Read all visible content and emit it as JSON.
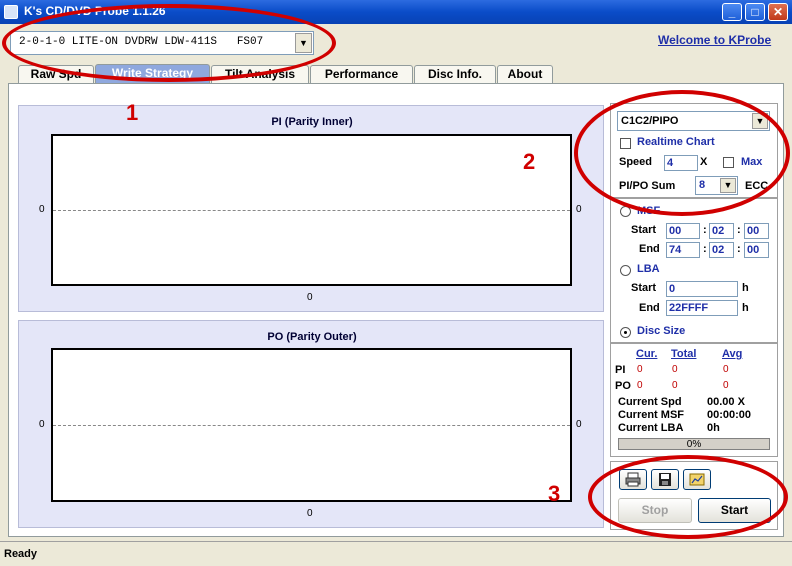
{
  "window": {
    "title": "K's CD/DVD Probe 1.1.26"
  },
  "drive_select": {
    "value": "2-0-1-0 LITE-ON DVDRW LDW-411S   FS07"
  },
  "welcome_link": "Welcome to KProbe",
  "tabs": [
    {
      "label": "Raw Spd"
    },
    {
      "label": "Write Strategy",
      "active": true
    },
    {
      "label": "Tilt Analysis"
    },
    {
      "label": "Performance"
    },
    {
      "label": "Disc Info."
    },
    {
      "label": "About"
    }
  ],
  "pi_chart": {
    "title": "PI (Parity Inner)",
    "y_left": "0",
    "y_right": "0",
    "x_label": "0"
  },
  "po_chart": {
    "title": "PO (Parity Outer)",
    "y_left": "0",
    "y_right": "0",
    "x_label": "0"
  },
  "settings": {
    "mode": "C1C2/PIPO",
    "realtime_chart": "Realtime Chart",
    "speed_label": "Speed",
    "speed_value": "4",
    "speed_unit": "X",
    "max_label": "Max",
    "sum_label": "PI/PO Sum",
    "sum_value": "8",
    "ecc_label": "ECC"
  },
  "range": {
    "msf_label": "MSF",
    "start_label": "Start",
    "end_label": "End",
    "msf_start": [
      "00",
      "02",
      "00"
    ],
    "msf_end": [
      "74",
      "02",
      "00"
    ],
    "sep": ":",
    "lba_label": "LBA",
    "lba_start": "0",
    "lba_end": "22FFFF",
    "h": "h",
    "disc_size_label": "Disc Size",
    "selected": "Disc Size"
  },
  "stats": {
    "headers": [
      "Cur.",
      "Total",
      "Avg"
    ],
    "rows": [
      {
        "label": "PI",
        "values": [
          "0",
          "0",
          "0"
        ]
      },
      {
        "label": "PO",
        "values": [
          "0",
          "0",
          "0"
        ]
      }
    ],
    "current_spd_label": "Current Spd",
    "current_spd": "00.00 X",
    "current_msf_label": "Current MSF",
    "current_msf": "00:00:00",
    "current_lba_label": "Current LBA",
    "current_lba": "0h",
    "progress_text": "0%",
    "progress": 0
  },
  "actions": {
    "stop": "Stop",
    "start": "Start"
  },
  "status": "Ready",
  "annotations": [
    "1",
    "2",
    "3"
  ],
  "colors": {
    "title_bar": "#0A4CC8",
    "chart_bg": "#E4E6F8",
    "annotation": "#D00000",
    "link": "#1F2FA8"
  }
}
